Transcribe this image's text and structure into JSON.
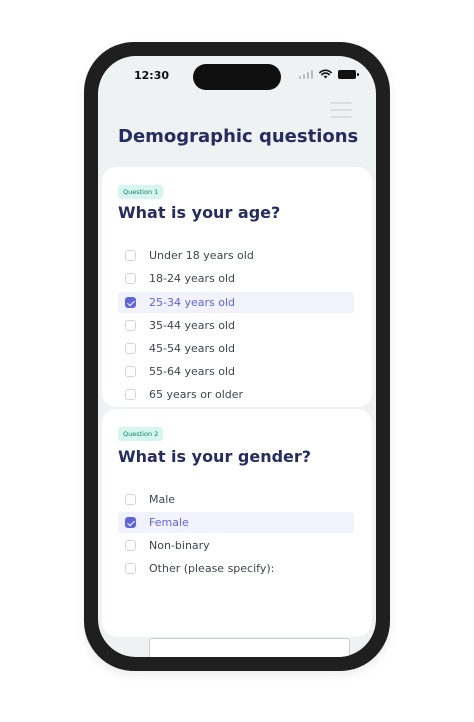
{
  "status_bar": {
    "time": "12:30"
  },
  "page": {
    "title": "Demographic questions"
  },
  "questions": [
    {
      "badge": "Question 1",
      "title": "What is your age?",
      "options": [
        {
          "label": "Under 18 years old",
          "selected": false
        },
        {
          "label": "18-24 years old",
          "selected": false
        },
        {
          "label": "25-34 years old",
          "selected": true
        },
        {
          "label": "35-44 years old",
          "selected": false
        },
        {
          "label": "45-54 years old",
          "selected": false
        },
        {
          "label": "55-64 years old",
          "selected": false
        },
        {
          "label": "65 years or older",
          "selected": false
        }
      ]
    },
    {
      "badge": "Question 2",
      "title": "What is your gender?",
      "options": [
        {
          "label": "Male",
          "selected": false
        },
        {
          "label": "Female",
          "selected": true
        },
        {
          "label": "Non-binary",
          "selected": false
        },
        {
          "label": "Other (please specify):",
          "selected": false
        }
      ],
      "other_input_value": ""
    }
  ],
  "colors": {
    "accent": "#6065d9",
    "title": "#262c5e",
    "badge_bg": "#d4f6ee",
    "badge_text": "#17796a",
    "selected_bg": "#f1f2fc"
  }
}
